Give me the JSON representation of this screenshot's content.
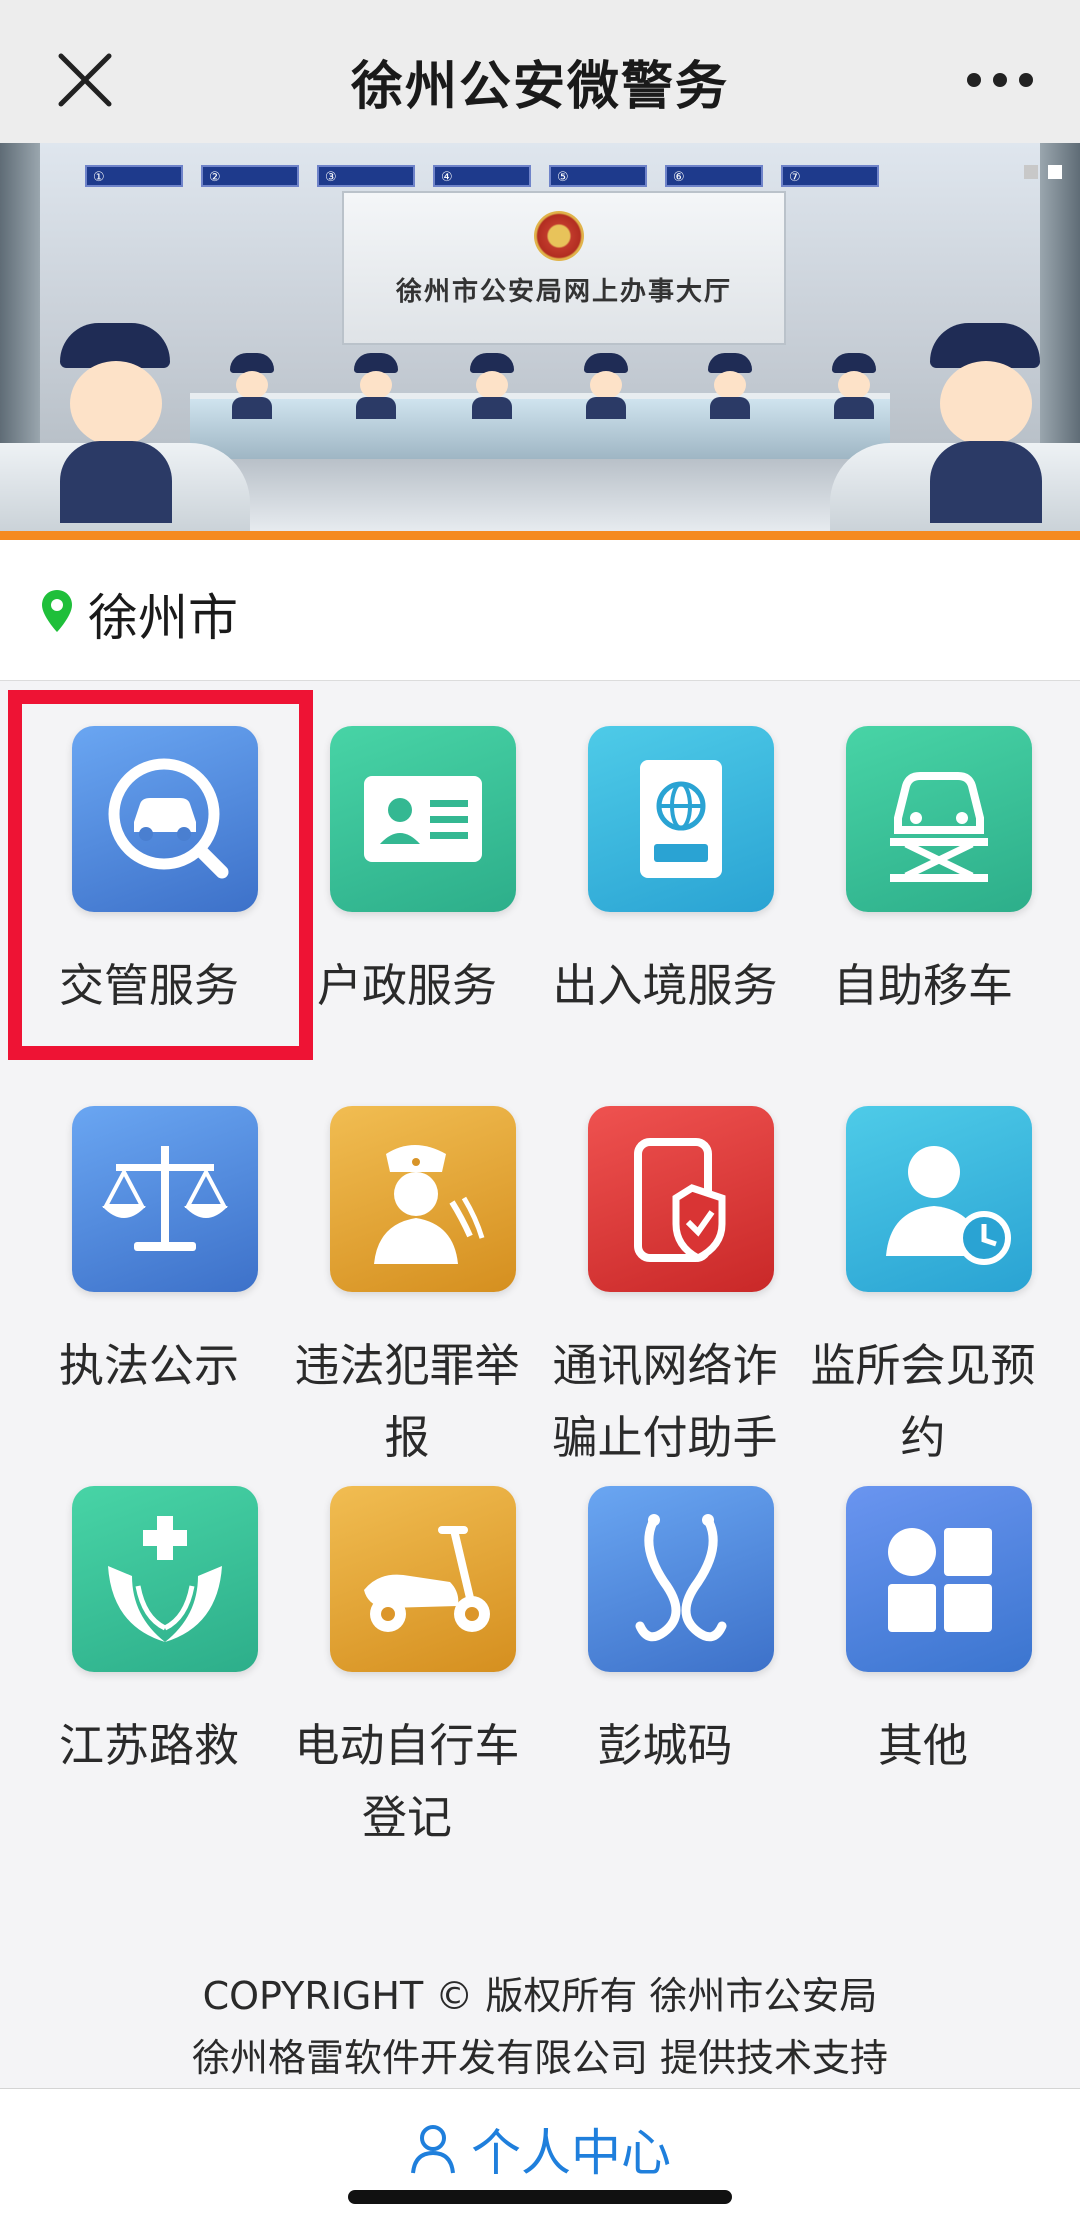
{
  "navbar": {
    "title": "徐州公安微警务",
    "close_icon": "close-icon",
    "more_icon": "more-dots-icon"
  },
  "banner": {
    "hall_title": "徐州市公安局网上办事大厅",
    "slides_total": 2,
    "active_slide": 2
  },
  "location": {
    "icon": "location-pin-icon",
    "city": "徐州市",
    "icon_color": "#1fbf3a"
  },
  "services": [
    {
      "label": "交管服务",
      "icon": "car-search-icon",
      "colors": [
        "#6aa6f2",
        "#3d71c9"
      ]
    },
    {
      "label": "户政服务",
      "icon": "id-card-icon",
      "colors": [
        "#48d4a6",
        "#2dae8a"
      ]
    },
    {
      "label": "出入境服务",
      "icon": "passport-icon",
      "colors": [
        "#4ecbe8",
        "#2aa3d3"
      ]
    },
    {
      "label": "自助移车",
      "icon": "tow-lift-icon",
      "colors": [
        "#48d4a6",
        "#2dae8a"
      ]
    },
    {
      "label": "执法公示",
      "icon": "scales-icon",
      "colors": [
        "#6aa6f2",
        "#3d71c9"
      ]
    },
    {
      "label": "违法犯罪举报",
      "icon": "police-phone-icon",
      "colors": [
        "#f1bd52",
        "#d58f1f"
      ]
    },
    {
      "label": "通讯网络诈骗止付助手",
      "icon": "phone-shield-icon",
      "colors": [
        "#ef5250",
        "#c92828"
      ]
    },
    {
      "label": "监所会见预约",
      "icon": "person-clock-icon",
      "colors": [
        "#4ecbe8",
        "#2aa3d3"
      ]
    },
    {
      "label": "江苏路救",
      "icon": "rescue-hands-icon",
      "colors": [
        "#48d4a6",
        "#2dae8a"
      ]
    },
    {
      "label": "电动自行车登记",
      "icon": "scooter-icon",
      "colors": [
        "#f1bd52",
        "#d58f1f"
      ]
    },
    {
      "label": "彭城码",
      "icon": "stethoscope-icon",
      "colors": [
        "#6aa6f2",
        "#3d71c9"
      ]
    },
    {
      "label": "其他",
      "icon": "apps-grid-icon",
      "colors": [
        "#6a95f0",
        "#3b75cf"
      ]
    }
  ],
  "highlight": {
    "color": "#ee1334",
    "target": "交管服务"
  },
  "footer": {
    "line1": "COPYRIGHT © 版权所有 徐州市公安局",
    "line2": "徐州格雷软件开发有限公司 提供技术支持"
  },
  "tabbar": {
    "label": "个人中心",
    "icon": "user-outline-icon",
    "color": "#1f7fdc"
  }
}
